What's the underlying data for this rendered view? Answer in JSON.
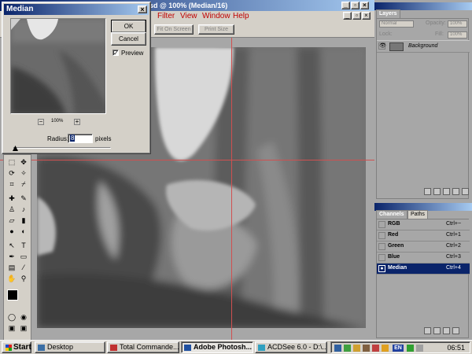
{
  "window": {
    "title": "sd @ 100% (Median/16)",
    "minimize": "_",
    "restore": "▫",
    "close": "×"
  },
  "menu": {
    "items": [
      "Filter",
      "View",
      "Window",
      "Help"
    ]
  },
  "options_bar": {
    "buttons": [
      "Fit On Screen",
      "Print Size"
    ]
  },
  "median_dialog": {
    "title": "Median",
    "close_label": "×",
    "ok_label": "OK",
    "cancel_label": "Cancel",
    "preview_label": "Preview",
    "preview_checked": "✓",
    "zoom_out": "−",
    "zoom_in": "+",
    "zoom_value": "100%",
    "radius_label": "Radius:",
    "radius_value": "8",
    "radius_unit": "pixels"
  },
  "layers_palette": {
    "tab": "Layers",
    "blend_mode": "Normal",
    "opacity_label": "Opacity:",
    "opacity_value": "100%",
    "lock_label": "Lock:",
    "fill_label": "Fill:",
    "fill_value": "100%",
    "layers": [
      {
        "name": "Background"
      }
    ]
  },
  "channels_palette": {
    "tabs": [
      "Channels",
      "Paths"
    ],
    "channels": [
      {
        "name": "RGB",
        "shortcut": "Ctrl+~"
      },
      {
        "name": "Red",
        "shortcut": "Ctrl+1"
      },
      {
        "name": "Green",
        "shortcut": "Ctrl+2"
      },
      {
        "name": "Blue",
        "shortcut": "Ctrl+3"
      },
      {
        "name": "Median",
        "shortcut": "Ctrl+4",
        "selected": true
      }
    ]
  },
  "taskbar": {
    "start_label": "Start",
    "tasks": [
      {
        "label": "Desktop",
        "icon_color": "#3a6ea5"
      },
      {
        "label": "Total Comma​nde...",
        "icon_color": "#c03030"
      },
      {
        "label": "Adobe Photosh...",
        "icon_color": "#2050a0",
        "active": true
      },
      {
        "label": "ACDSee 6.0 - D:\\...",
        "icon_color": "#30a0c0"
      }
    ],
    "tray_icons": [
      "monitor-icon",
      "network-icon",
      "folder-icon",
      "speaker-icon",
      "shield-icon",
      "language-en-icon",
      "antivirus-icon",
      "globe-icon"
    ],
    "language": "EN",
    "clock": "06:51"
  },
  "colors": {
    "titlebar_start": "#0a246a",
    "titlebar_end": "#a6caf0",
    "guide": "#d05050",
    "selection": "#0a246a"
  }
}
